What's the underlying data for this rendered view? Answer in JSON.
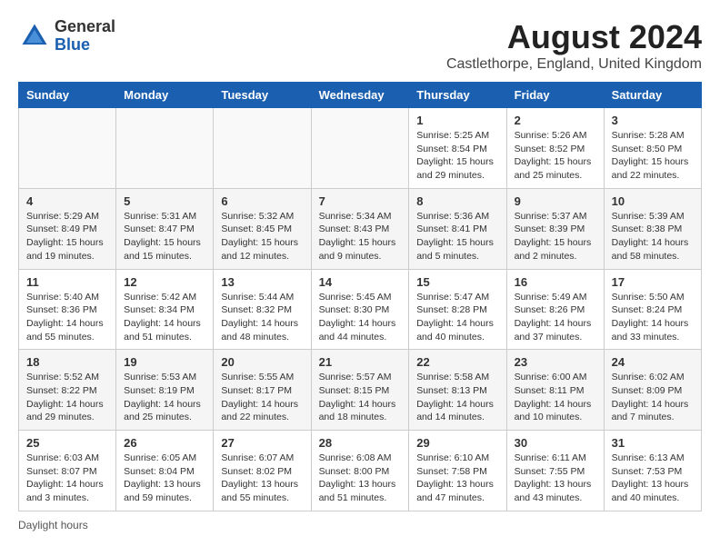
{
  "header": {
    "logo_general": "General",
    "logo_blue": "Blue",
    "month_title": "August 2024",
    "location": "Castlethorpe, England, United Kingdom"
  },
  "days_of_week": [
    "Sunday",
    "Monday",
    "Tuesday",
    "Wednesday",
    "Thursday",
    "Friday",
    "Saturday"
  ],
  "weeks": [
    [
      {
        "day": "",
        "info": ""
      },
      {
        "day": "",
        "info": ""
      },
      {
        "day": "",
        "info": ""
      },
      {
        "day": "",
        "info": ""
      },
      {
        "day": "1",
        "info": "Sunrise: 5:25 AM\nSunset: 8:54 PM\nDaylight: 15 hours\nand 29 minutes."
      },
      {
        "day": "2",
        "info": "Sunrise: 5:26 AM\nSunset: 8:52 PM\nDaylight: 15 hours\nand 25 minutes."
      },
      {
        "day": "3",
        "info": "Sunrise: 5:28 AM\nSunset: 8:50 PM\nDaylight: 15 hours\nand 22 minutes."
      }
    ],
    [
      {
        "day": "4",
        "info": "Sunrise: 5:29 AM\nSunset: 8:49 PM\nDaylight: 15 hours\nand 19 minutes."
      },
      {
        "day": "5",
        "info": "Sunrise: 5:31 AM\nSunset: 8:47 PM\nDaylight: 15 hours\nand 15 minutes."
      },
      {
        "day": "6",
        "info": "Sunrise: 5:32 AM\nSunset: 8:45 PM\nDaylight: 15 hours\nand 12 minutes."
      },
      {
        "day": "7",
        "info": "Sunrise: 5:34 AM\nSunset: 8:43 PM\nDaylight: 15 hours\nand 9 minutes."
      },
      {
        "day": "8",
        "info": "Sunrise: 5:36 AM\nSunset: 8:41 PM\nDaylight: 15 hours\nand 5 minutes."
      },
      {
        "day": "9",
        "info": "Sunrise: 5:37 AM\nSunset: 8:39 PM\nDaylight: 15 hours\nand 2 minutes."
      },
      {
        "day": "10",
        "info": "Sunrise: 5:39 AM\nSunset: 8:38 PM\nDaylight: 14 hours\nand 58 minutes."
      }
    ],
    [
      {
        "day": "11",
        "info": "Sunrise: 5:40 AM\nSunset: 8:36 PM\nDaylight: 14 hours\nand 55 minutes."
      },
      {
        "day": "12",
        "info": "Sunrise: 5:42 AM\nSunset: 8:34 PM\nDaylight: 14 hours\nand 51 minutes."
      },
      {
        "day": "13",
        "info": "Sunrise: 5:44 AM\nSunset: 8:32 PM\nDaylight: 14 hours\nand 48 minutes."
      },
      {
        "day": "14",
        "info": "Sunrise: 5:45 AM\nSunset: 8:30 PM\nDaylight: 14 hours\nand 44 minutes."
      },
      {
        "day": "15",
        "info": "Sunrise: 5:47 AM\nSunset: 8:28 PM\nDaylight: 14 hours\nand 40 minutes."
      },
      {
        "day": "16",
        "info": "Sunrise: 5:49 AM\nSunset: 8:26 PM\nDaylight: 14 hours\nand 37 minutes."
      },
      {
        "day": "17",
        "info": "Sunrise: 5:50 AM\nSunset: 8:24 PM\nDaylight: 14 hours\nand 33 minutes."
      }
    ],
    [
      {
        "day": "18",
        "info": "Sunrise: 5:52 AM\nSunset: 8:22 PM\nDaylight: 14 hours\nand 29 minutes."
      },
      {
        "day": "19",
        "info": "Sunrise: 5:53 AM\nSunset: 8:19 PM\nDaylight: 14 hours\nand 25 minutes."
      },
      {
        "day": "20",
        "info": "Sunrise: 5:55 AM\nSunset: 8:17 PM\nDaylight: 14 hours\nand 22 minutes."
      },
      {
        "day": "21",
        "info": "Sunrise: 5:57 AM\nSunset: 8:15 PM\nDaylight: 14 hours\nand 18 minutes."
      },
      {
        "day": "22",
        "info": "Sunrise: 5:58 AM\nSunset: 8:13 PM\nDaylight: 14 hours\nand 14 minutes."
      },
      {
        "day": "23",
        "info": "Sunrise: 6:00 AM\nSunset: 8:11 PM\nDaylight: 14 hours\nand 10 minutes."
      },
      {
        "day": "24",
        "info": "Sunrise: 6:02 AM\nSunset: 8:09 PM\nDaylight: 14 hours\nand 7 minutes."
      }
    ],
    [
      {
        "day": "25",
        "info": "Sunrise: 6:03 AM\nSunset: 8:07 PM\nDaylight: 14 hours\nand 3 minutes."
      },
      {
        "day": "26",
        "info": "Sunrise: 6:05 AM\nSunset: 8:04 PM\nDaylight: 13 hours\nand 59 minutes."
      },
      {
        "day": "27",
        "info": "Sunrise: 6:07 AM\nSunset: 8:02 PM\nDaylight: 13 hours\nand 55 minutes."
      },
      {
        "day": "28",
        "info": "Sunrise: 6:08 AM\nSunset: 8:00 PM\nDaylight: 13 hours\nand 51 minutes."
      },
      {
        "day": "29",
        "info": "Sunrise: 6:10 AM\nSunset: 7:58 PM\nDaylight: 13 hours\nand 47 minutes."
      },
      {
        "day": "30",
        "info": "Sunrise: 6:11 AM\nSunset: 7:55 PM\nDaylight: 13 hours\nand 43 minutes."
      },
      {
        "day": "31",
        "info": "Sunrise: 6:13 AM\nSunset: 7:53 PM\nDaylight: 13 hours\nand 40 minutes."
      }
    ]
  ],
  "footer": {
    "daylight_hours_label": "Daylight hours"
  }
}
